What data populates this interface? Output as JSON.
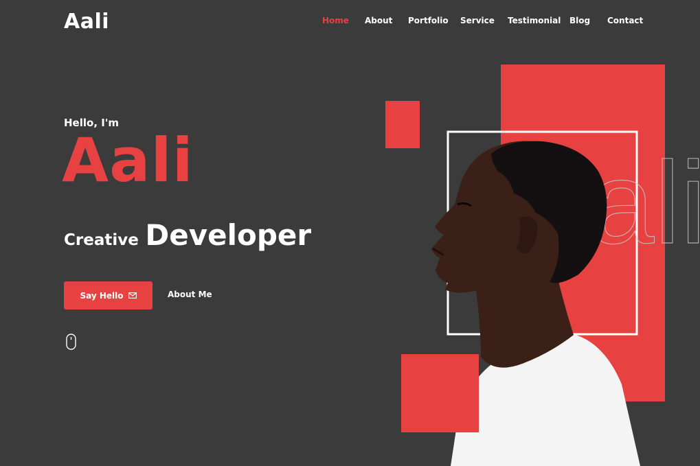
{
  "brand": {
    "logo": "Aali"
  },
  "nav": {
    "items": [
      {
        "label": "Home",
        "active": true
      },
      {
        "label": "About"
      },
      {
        "label": "Portfolio"
      },
      {
        "label": "Service"
      },
      {
        "label": "Testimonial"
      },
      {
        "label": "Blog"
      },
      {
        "label": "Contact"
      }
    ]
  },
  "hero": {
    "greeting": "Hello, I'm",
    "name": "Aali",
    "role_prefix": "Creative",
    "role_main": "Developer",
    "primary_button": "Say Hello",
    "secondary_button": "About Me",
    "watermark": "ali"
  },
  "icons": {
    "envelope": "envelope-icon",
    "mouse": "mouse-scroll-icon"
  },
  "colors": {
    "background": "#3b3b3c",
    "accent": "#e84142",
    "text": "#ffffff",
    "shirt": "#f4f4f4",
    "skin": "#3b2017"
  }
}
